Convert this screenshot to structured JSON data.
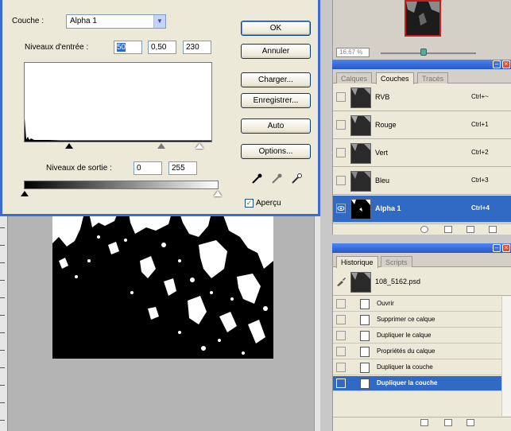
{
  "levels_dialog": {
    "channel_label": "Couche :",
    "channel_value": "Alpha 1",
    "input_levels_label": "Niveaux d'entrée :",
    "input_black": "50",
    "input_gamma": "0,50",
    "input_white": "230",
    "output_levels_label": "Niveaux de sortie :",
    "output_black": "0",
    "output_white": "255",
    "buttons": {
      "ok": "OK",
      "cancel": "Annuler",
      "load": "Charger...",
      "save": "Enregistrer...",
      "auto": "Auto",
      "options": "Options..."
    },
    "preview_label": "Aperçu",
    "preview_checked": true
  },
  "navigator": {
    "zoom": "16,67 %"
  },
  "channels_panel": {
    "tabs": [
      "Calques",
      "Couches",
      "Tracés"
    ],
    "active_tab": "Couches",
    "rows": [
      {
        "name": "RVB",
        "shortcut": "Ctrl+~",
        "selected": false
      },
      {
        "name": "Rouge",
        "shortcut": "Ctrl+1",
        "selected": false
      },
      {
        "name": "Vert",
        "shortcut": "Ctrl+2",
        "selected": false
      },
      {
        "name": "Bleu",
        "shortcut": "Ctrl+3",
        "selected": false
      },
      {
        "name": "Alpha 1",
        "shortcut": "Ctrl+4",
        "selected": true
      }
    ]
  },
  "history_panel": {
    "tabs": [
      "Historique",
      "Scripts"
    ],
    "active_tab": "Historique",
    "snapshot": "108_5162.psd",
    "steps": [
      {
        "label": "Ouvrir",
        "selected": false
      },
      {
        "label": "Supprimer ce calque",
        "selected": false
      },
      {
        "label": "Dupliquer le calque",
        "selected": false
      },
      {
        "label": "Propriétés du calque",
        "selected": false
      },
      {
        "label": "Dupliquer la couche",
        "selected": false
      },
      {
        "label": "Dupliquer la couche",
        "selected": true
      }
    ]
  },
  "colors": {
    "xp_blue": "#316ac5",
    "dialog_bg": "#ece9d8",
    "frame_blue": "#3a6ad6"
  }
}
